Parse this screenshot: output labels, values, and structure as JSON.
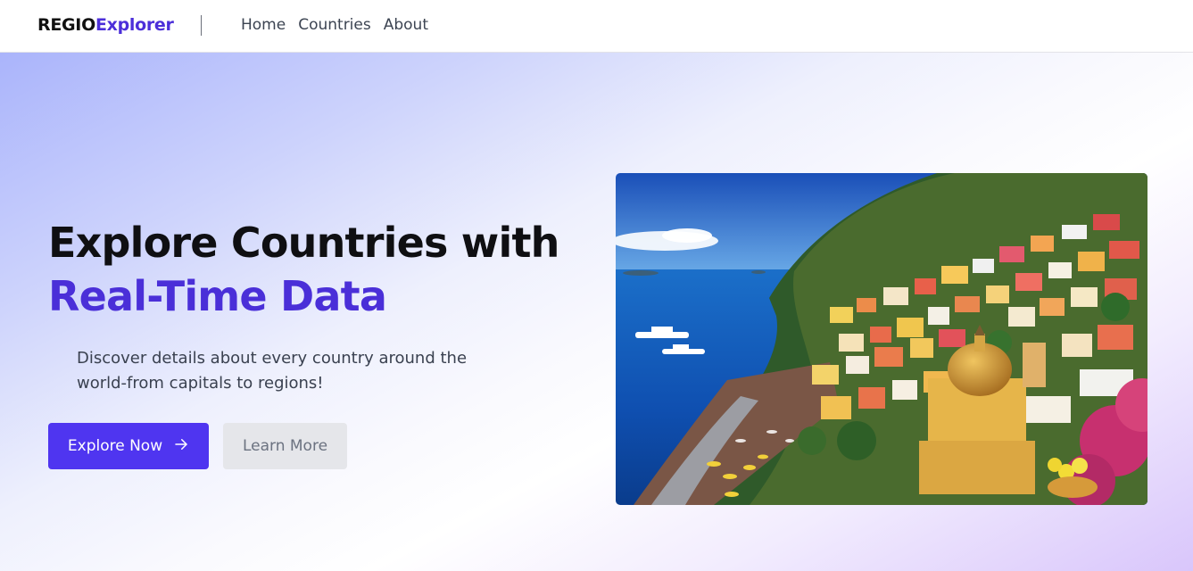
{
  "brand": {
    "part1": "REGIO",
    "part2": "Explorer"
  },
  "nav": {
    "links": [
      "Home",
      "Countries",
      "About"
    ]
  },
  "hero": {
    "headline_line1": "Explore Countries with",
    "headline_line2": "Real-Time Data",
    "description": "Discover details about every country around the world-from capitals to regions!",
    "primary_button": "Explore Now",
    "primary_icon": "arrow-right-icon",
    "secondary_button": "Learn More"
  },
  "colors": {
    "accent": "#4f35f0",
    "accent_text": "#4a2fd8",
    "secondary_button_bg": "#e5e6ea",
    "nav_text": "#3c4452"
  }
}
